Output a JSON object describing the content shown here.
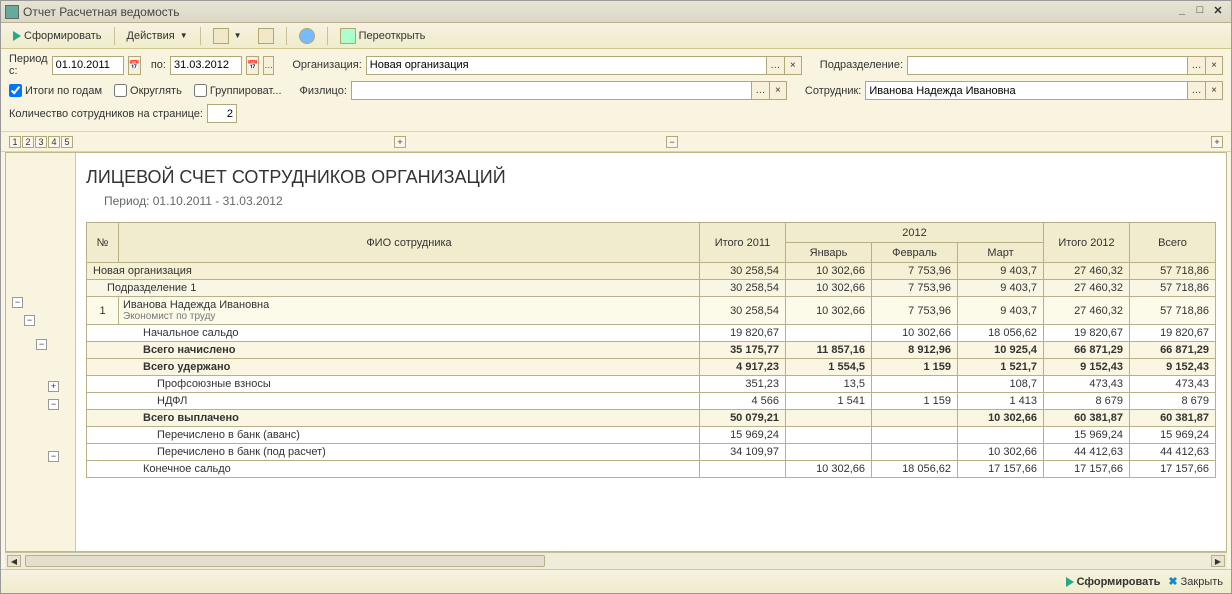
{
  "window": {
    "title": "Отчет  Расчетная ведомость"
  },
  "toolbar": {
    "form": "Сформировать",
    "actions": "Действия",
    "reopen": "Переоткрыть"
  },
  "filters": {
    "period_from_label": "Период с:",
    "period_from": "01.10.2011",
    "period_to_label": "по:",
    "period_to": "31.03.2012",
    "org_label": "Организация:",
    "org_value": "Новая организация",
    "dep_label": "Подразделение:",
    "dep_value": "",
    "yearly_label": "Итоги по годам",
    "round_label": "Округлять",
    "group_label": "Группироват...",
    "person_label": "Физлицо:",
    "person_value": "",
    "employee_label": "Сотрудник:",
    "employee_value": "Иванова Надежда Ивановна",
    "count_label": "Количество сотрудников на странице:",
    "count_value": "2"
  },
  "report": {
    "title": "ЛИЦЕВОЙ СЧЕТ СОТРУДНИКОВ ОРГАНИЗАЦИЙ",
    "period": "Период: 01.10.2011 - 31.03.2012",
    "headers": {
      "num": "№",
      "fio": "ФИО сотрудника",
      "total2011": "Итого 2011",
      "year2012": "2012",
      "jan": "Январь",
      "feb": "Февраль",
      "mar": "Март",
      "total2012": "Итого 2012",
      "grand": "Всего"
    },
    "rows": {
      "org": {
        "name": "Новая организация",
        "t11": "30 258,54",
        "jan": "10 302,66",
        "feb": "7 753,96",
        "mar": "9 403,7",
        "t12": "27 460,32",
        "all": "57 718,86"
      },
      "subdiv": {
        "name": "Подразделение 1",
        "t11": "30 258,54",
        "jan": "10 302,66",
        "feb": "7 753,96",
        "mar": "9 403,7",
        "t12": "27 460,32",
        "all": "57 718,86"
      },
      "emp": {
        "num": "1",
        "name": "Иванова Надежда Ивановна",
        "pos": "Экономист по труду",
        "t11": "30 258,54",
        "jan": "10 302,66",
        "feb": "7 753,96",
        "mar": "9 403,7",
        "t12": "27 460,32",
        "all": "57 718,86"
      },
      "start": {
        "name": "Начальное сальдо",
        "t11": "19 820,67",
        "jan": "",
        "feb": "10 302,66",
        "mar": "18 056,62",
        "t12": "19 820,67",
        "all": "19 820,67"
      },
      "accrued": {
        "name": "Всего начислено",
        "t11": "35 175,77",
        "jan": "11 857,16",
        "feb": "8 912,96",
        "mar": "10 925,4",
        "t12": "66 871,29",
        "all": "66 871,29"
      },
      "withheld": {
        "name": "Всего удержано",
        "t11": "4 917,23",
        "jan": "1 554,5",
        "feb": "1 159",
        "mar": "1 521,7",
        "t12": "9 152,43",
        "all": "9 152,43"
      },
      "union": {
        "name": "Профсоюзные взносы",
        "t11": "351,23",
        "jan": "13,5",
        "feb": "",
        "mar": "108,7",
        "t12": "473,43",
        "all": "473,43"
      },
      "ndfl": {
        "name": "НДФЛ",
        "t11": "4 566",
        "jan": "1 541",
        "feb": "1 159",
        "mar": "1 413",
        "t12": "8 679",
        "all": "8 679"
      },
      "paid": {
        "name": "Всего выплачено",
        "t11": "50 079,21",
        "jan": "",
        "feb": "",
        "mar": "10 302,66",
        "t12": "60 381,87",
        "all": "60 381,87"
      },
      "advance": {
        "name": "Перечислено в банк (аванс)",
        "t11": "15 969,24",
        "jan": "",
        "feb": "",
        "mar": "",
        "t12": "15 969,24",
        "all": "15 969,24"
      },
      "final": {
        "name": "Перечислено в банк (под расчет)",
        "t11": "34 109,97",
        "jan": "",
        "feb": "",
        "mar": "10 302,66",
        "t12": "44 412,63",
        "all": "44 412,63"
      },
      "end": {
        "name": "Конечное сальдо",
        "t11": "",
        "jan": "10 302,66",
        "feb": "18 056,62",
        "mar": "17 157,66",
        "t12": "17 157,66",
        "all": "17 157,66"
      }
    }
  },
  "bottom": {
    "form": "Сформировать",
    "close": "Закрыть"
  }
}
